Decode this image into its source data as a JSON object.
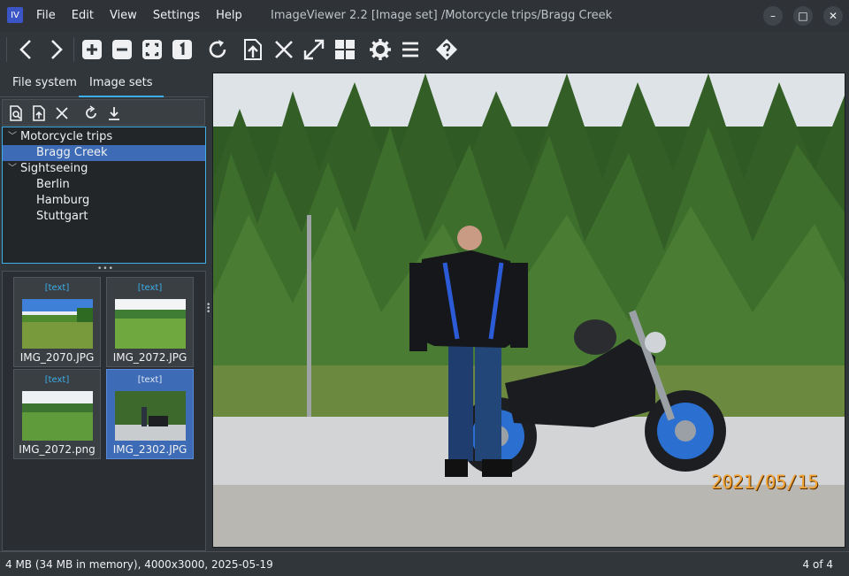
{
  "app": {
    "icon_text": "IV",
    "window_title": "ImageViewer 2.2 [Image set] /Motorcycle trips/Bragg Creek"
  },
  "menu": [
    "File",
    "Edit",
    "View",
    "Settings",
    "Help"
  ],
  "window_controls": {
    "minimize": "–",
    "maximize": "□",
    "close": "✕"
  },
  "toolbar": {
    "icons": [
      "previous-icon",
      "next-icon",
      "zoom-in-icon",
      "zoom-out-icon",
      "fit-to-window-icon",
      "actual-size-icon",
      "rotate-icon",
      "export-icon",
      "close-image-icon",
      "fullscreen-icon",
      "thumbnails-icon",
      "settings-icon",
      "menu-icon",
      "help-icon"
    ]
  },
  "left_panel": {
    "tabs": [
      "File system",
      "Image sets"
    ],
    "active_tab": "Image sets",
    "mini_toolbar_icons": [
      "new-set-icon",
      "add-to-set-icon",
      "remove-icon",
      "refresh-icon",
      "download-icon"
    ],
    "tree": [
      {
        "label": "Motorcycle trips",
        "level": 0,
        "expanded": true
      },
      {
        "label": "Bragg Creek",
        "level": 1,
        "selected": true
      },
      {
        "label": "Sightseeing",
        "level": 0,
        "expanded": true
      },
      {
        "label": "Berlin",
        "level": 1
      },
      {
        "label": "Hamburg",
        "level": 1
      },
      {
        "label": "Stuttgart",
        "level": 1
      }
    ],
    "thumbnails": [
      {
        "tag": "[text]",
        "name": "IMG_2070.JPG"
      },
      {
        "tag": "[text]",
        "name": "IMG_2072.JPG"
      },
      {
        "tag": "[text]",
        "name": "IMG_2072.png"
      },
      {
        "tag": "[text]",
        "name": "IMG_2302.JPG",
        "selected": true
      }
    ]
  },
  "viewer": {
    "date_stamp": "2021/05/15"
  },
  "status": {
    "info": "4 MB (34 MB in memory), 4000x3000, 2025-05-19",
    "position": "4 of 4"
  },
  "colors": {
    "accent": "#3daee9",
    "selection": "#3d6bb5",
    "background": "#31363b",
    "date_stamp": "#f1a336"
  }
}
